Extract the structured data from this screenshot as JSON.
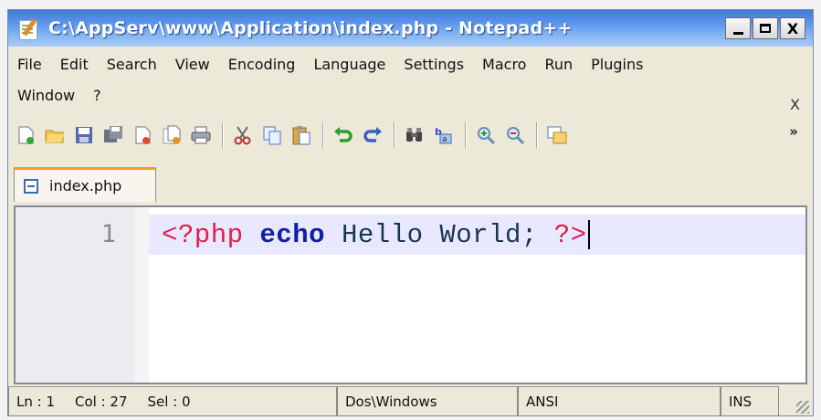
{
  "window": {
    "title": "C:\\AppServ\\www\\Application\\index.php - Notepad++",
    "controls": {
      "minimize": "_",
      "maximize": "□",
      "close": "X"
    }
  },
  "menu": {
    "row1": [
      "File",
      "Edit",
      "Search",
      "View",
      "Encoding",
      "Language",
      "Settings",
      "Macro",
      "Run",
      "Plugins"
    ],
    "row2": [
      "Window",
      "?"
    ],
    "close_doc": "X"
  },
  "toolbar": {
    "icons": [
      "new-file-icon",
      "open-file-icon",
      "save-icon",
      "save-all-icon",
      "close-icon",
      "close-all-icon",
      "print-icon",
      "cut-icon",
      "copy-icon",
      "paste-icon",
      "undo-icon",
      "redo-icon",
      "find-icon",
      "replace-icon",
      "zoom-in-icon",
      "zoom-out-icon",
      "sync-view-icon"
    ],
    "overflow": "»"
  },
  "tab": {
    "label": "index.php"
  },
  "editor": {
    "line_number": "1",
    "code": {
      "open_tag": "<?php",
      "keyword": "echo",
      "text": "Hello World;",
      "close_tag": "?>"
    }
  },
  "status": {
    "ln": "Ln : 1",
    "col": "Col : 27",
    "sel": "Sel : 0",
    "eol": "Dos\\Windows",
    "encoding": "ANSI",
    "mode": "INS"
  },
  "colors": {
    "title_bar": "#4a86e0",
    "php_tag": "#e0204a",
    "keyword": "#1020a0",
    "current_line": "#e8e8ff",
    "tab_accent": "#f0a020"
  }
}
